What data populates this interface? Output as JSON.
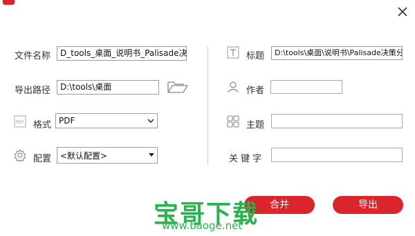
{
  "window": {
    "close_icon": "close-icon"
  },
  "left": {
    "filename": {
      "label": "文件名称",
      "value": "D_tools_桌面_说明书_Palisade决策分析"
    },
    "export_path": {
      "label": "导出路径",
      "value": "D:\\tools\\桌面",
      "icon": "folder-open-icon"
    },
    "format": {
      "label": "格式",
      "value": "PDF",
      "icon": "pdf-icon"
    },
    "config": {
      "label": "配置",
      "value": "<默认配置>",
      "icon": "settings-gear-icon"
    }
  },
  "right": {
    "title": {
      "label": "标题",
      "value": "D:\\tools\\桌面\\说明书\\Palisade决策分析",
      "icon": "text-T-icon"
    },
    "author": {
      "label": "作者",
      "value": "",
      "icon": "person-icon"
    },
    "subject": {
      "label": "主题",
      "value": "",
      "icon": "grid-icon"
    },
    "keywords": {
      "label": "关 键 字",
      "value": ""
    }
  },
  "buttons": {
    "merge": "合并",
    "export": "导出"
  },
  "watermark": {
    "text": "宝哥下载",
    "url": "www.baoge.net"
  },
  "colors": {
    "accent": "#d9252b",
    "watermark": "#2bb24c"
  }
}
